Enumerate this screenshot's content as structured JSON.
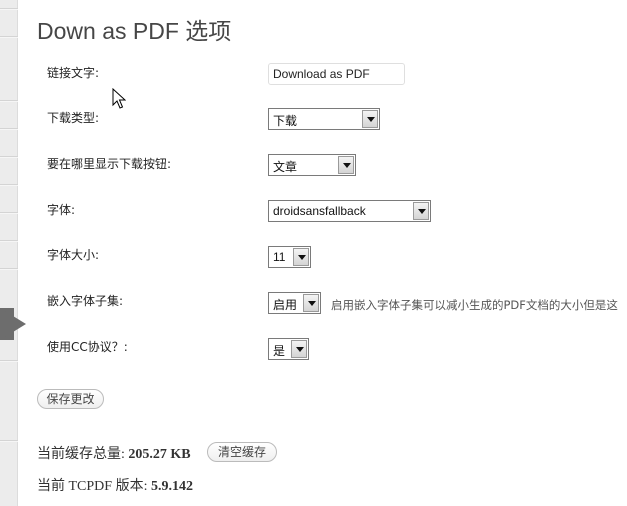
{
  "page": {
    "title": "Down as PDF 选项"
  },
  "settings": {
    "link_text": {
      "label": "链接文字:",
      "value": "Download as PDF"
    },
    "download_type": {
      "label": "下载类型:",
      "value": "下载"
    },
    "button_location": {
      "label": "要在哪里显示下载按钮:",
      "value": "文章"
    },
    "font": {
      "label": "字体:",
      "value": "droidsansfallback"
    },
    "font_size": {
      "label": "字体大小:",
      "value": "11"
    },
    "font_subsetting": {
      "label": "嵌入字体子集:",
      "value": "启用",
      "hint": "启用嵌入字体子集可以减小生成的PDF文档的大小但是这"
    },
    "cc_license": {
      "label": "使用CC协议？:",
      "value": "是"
    }
  },
  "actions": {
    "save": "保存更改",
    "clear_cache": "清空缓存"
  },
  "status": {
    "cache_label": "当前缓存总量:",
    "cache_value": "205.27 KB",
    "version_label": "当前 TCPDF 版本:",
    "version_value": "5.9.142"
  },
  "icons": {
    "cursor": "mouse-pointer-icon",
    "current_menu": "current-menu-arrow-icon"
  }
}
